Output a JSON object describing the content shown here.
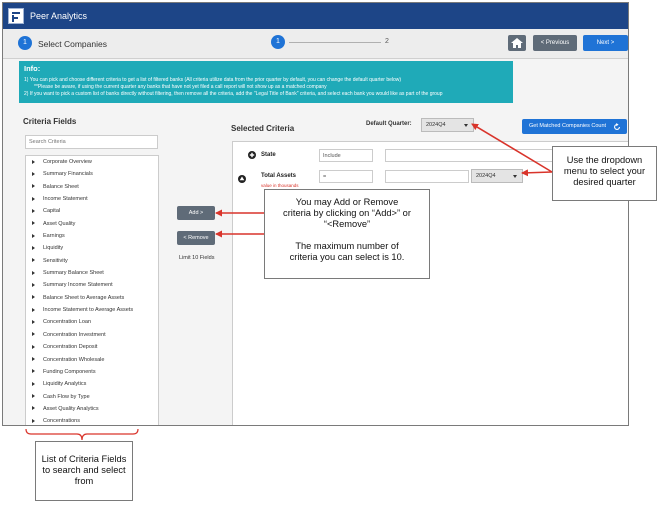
{
  "app": {
    "title": "Peer Analytics"
  },
  "stepper": {
    "current_number": "1",
    "current_title": "Select Companies",
    "step1": "1",
    "step2": "2",
    "prev_label": "< Previous",
    "next_label": "Next >"
  },
  "info": {
    "title": "Info:",
    "lines": [
      "1) You can pick and choose different criteria to get a list of filtered banks (All criteria utilize data from the prior quarter by default, you can change the default quarter below)",
      "**Please be aware, if using the current quarter any banks that have not yet filed a call report will not show up as a matched company",
      "2) If you want to pick a custom list of banks directly without filtering, then remove all the criteria, add the \"Legal Title of Bank\" criteria, and select each bank you would like as part of the group"
    ]
  },
  "criteria_fields": {
    "heading": "Criteria Fields",
    "search_placeholder": "Search Criteria",
    "items": [
      "Corporate Overview",
      "Summary Financials",
      "Balance Sheet",
      "Income Statement",
      "Capital",
      "Asset Quality",
      "Earnings",
      "Liquidity",
      "Sensitivity",
      "Summary Balance Sheet",
      "Summary Income Statement",
      "Balance Sheet to Average Assets",
      "Income Statement to Average Assets",
      "Concentration Loan",
      "Concentration Investment",
      "Concentration Deposit",
      "Concentration Wholesale",
      "Funding Components",
      "Liquidity Analytics",
      "Cash Flow by Type",
      "Asset Quality Analytics",
      "Concentrations"
    ]
  },
  "actions": {
    "add_label": "Add >",
    "remove_label": "< Remove",
    "limit_text": "Limit 10 Fields"
  },
  "selected": {
    "heading": "Selected Criteria",
    "default_quarter_label": "Default Quarter:",
    "default_quarter_value": "2024Q4",
    "count_button": "Get Matched Companies Count",
    "state": {
      "label": "State",
      "operator": "Include",
      "value": ""
    },
    "total_assets": {
      "label": "Total Assets",
      "sublabel": "value in thousands",
      "operator": "=",
      "value": "",
      "quarter": "2024Q4"
    }
  },
  "callouts": {
    "quarter": [
      "Use the dropdown",
      "menu to select your",
      "desired quarter"
    ],
    "add_remove": [
      "You may Add or Remove",
      "criteria by clicking on “Add>” or",
      "“<Remove”",
      "",
      "The maximum number of",
      "criteria you can select is 10."
    ],
    "list": [
      "List of Criteria Fields",
      "to search and select",
      "from"
    ]
  },
  "colors": {
    "topbar": "#1d4587",
    "primary": "#1f73d6",
    "info_bg": "#1faab8",
    "button_gray": "#5f6b78",
    "arrow": "#d9342b"
  },
  "icons": [
    "logo-icon",
    "home-icon",
    "refresh-icon",
    "plus-circle-icon",
    "up-circle-icon",
    "caret-icon",
    "triangle-right-icon"
  ]
}
